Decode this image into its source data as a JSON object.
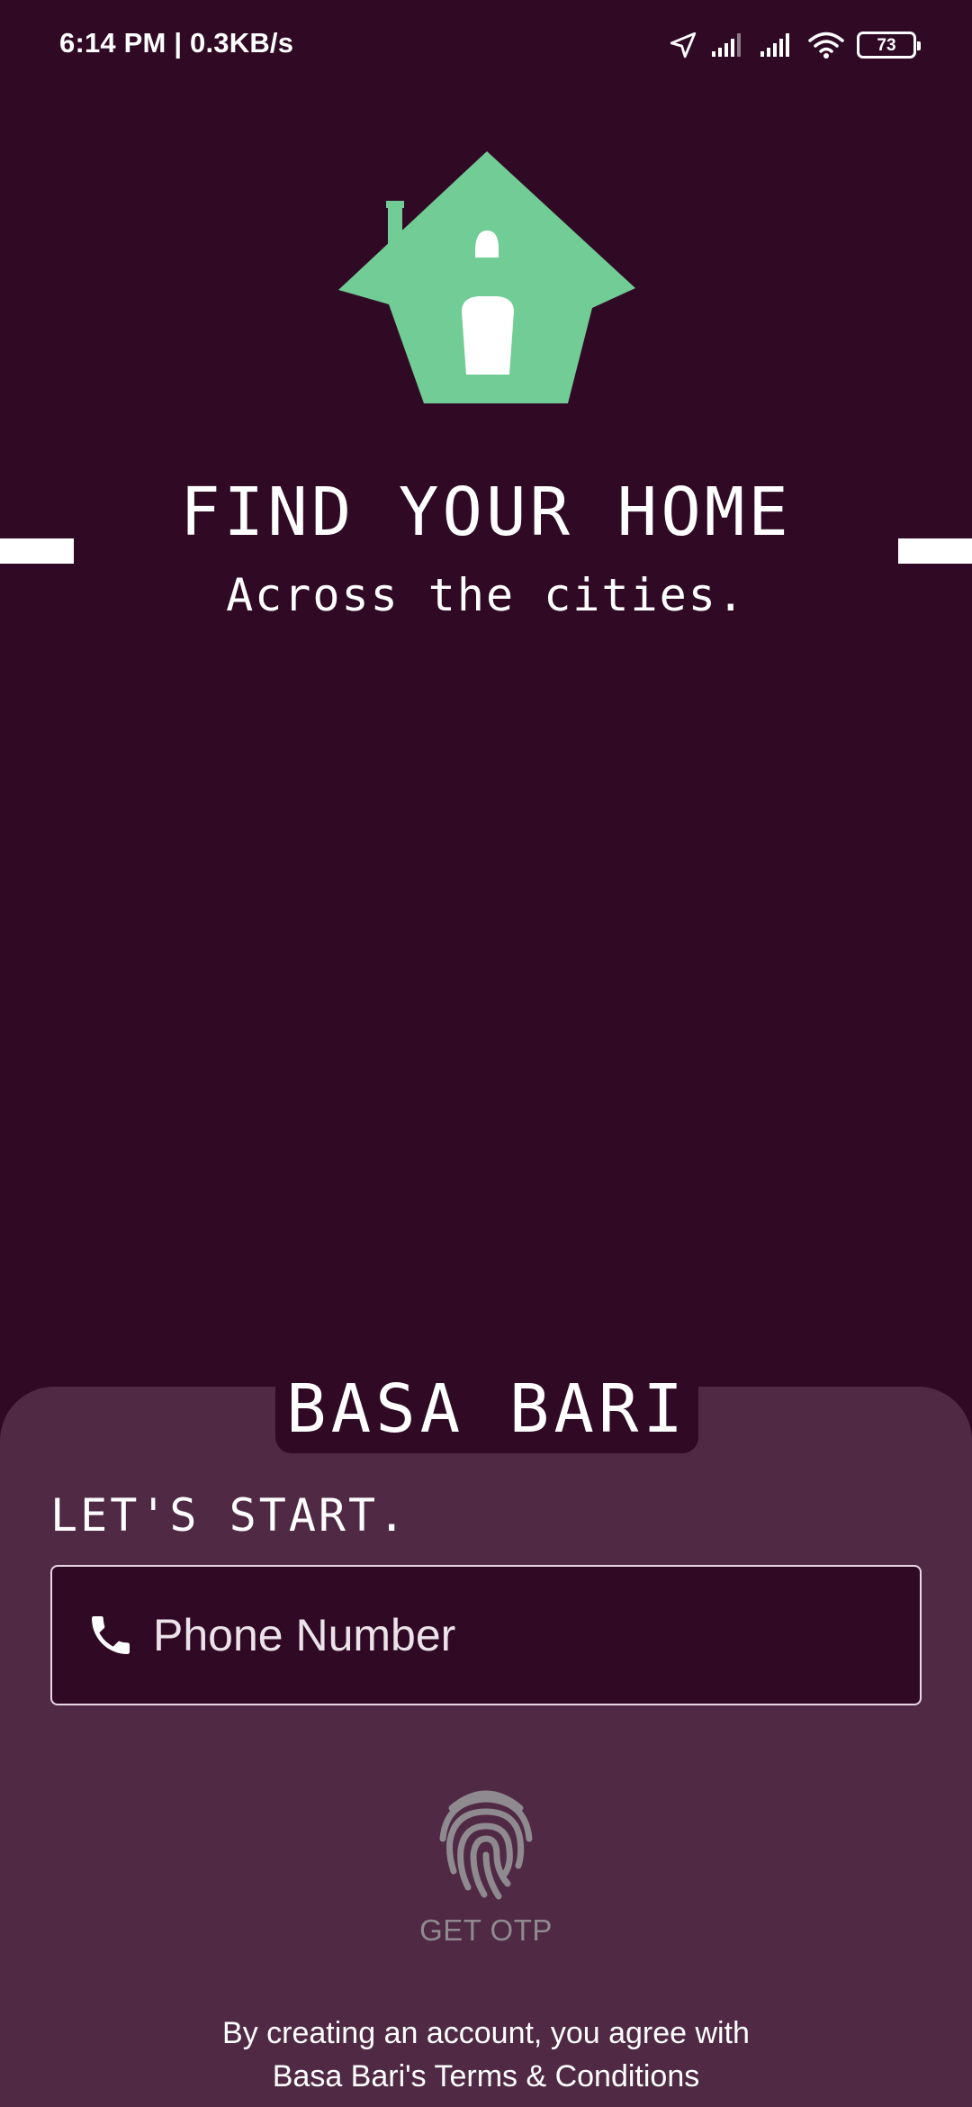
{
  "status_bar": {
    "time_speed": "6:14 PM | 0.3KB/s",
    "battery_level": "73",
    "icons": [
      "location-arrow-icon",
      "signal-icon",
      "signal-icon",
      "wifi-icon",
      "battery-icon"
    ]
  },
  "hero": {
    "logo_icon": "house-icon",
    "title": "FIND YOUR HOME",
    "subtitle": "Across the cities."
  },
  "sheet": {
    "brand": "BASA BARI",
    "heading": "LET'S START.",
    "phone_field": {
      "icon": "phone-icon",
      "placeholder": "Phone Number",
      "value": ""
    },
    "otp_button": {
      "icon": "fingerprint-icon",
      "label": "GET OTP"
    },
    "terms": {
      "line1": "By creating an account, you agree with",
      "line2": "Basa Bari's Terms & Conditions"
    }
  },
  "colors": {
    "background": "#300a25",
    "sheet": "#502945",
    "accent_green": "#72cc96",
    "disabled_gray": "#8f8a8f"
  }
}
